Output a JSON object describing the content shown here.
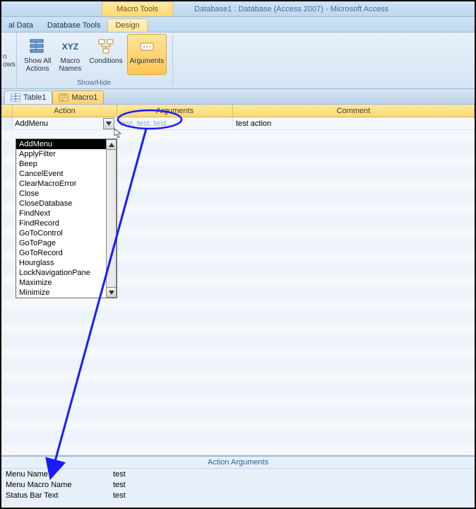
{
  "window": {
    "contextual_tab": "Macro Tools",
    "title": "Database1 : Database (Access 2007) - Microsoft Access"
  },
  "ribbon_tabs": {
    "external_data": "al Data",
    "db_tools": "Database Tools",
    "design": "Design"
  },
  "ribbon_left": {
    "line1": "n",
    "line2": "ows"
  },
  "ribbon_buttons": {
    "show_all": "Show All\nActions",
    "macro_names": "Macro\nNames",
    "conditions": "Conditions",
    "arguments": "Arguments"
  },
  "ribbon_group_label": "Show/Hide",
  "object_tabs": {
    "table1": "Table1",
    "macro1": "Macro1"
  },
  "grid_headers": {
    "action": "Action",
    "arguments": "Arguments",
    "comment": "Comment"
  },
  "row": {
    "action_value": "AddMenu",
    "args_preview": "test, test, test",
    "comment": "test action"
  },
  "action_dropdown": [
    "AddMenu",
    "ApplyFilter",
    "Beep",
    "CancelEvent",
    "ClearMacroError",
    "Close",
    "CloseDatabase",
    "FindNext",
    "FindRecord",
    "GoToControl",
    "GoToPage",
    "GoToRecord",
    "Hourglass",
    "LockNavigationPane",
    "Maximize",
    "Minimize"
  ],
  "args_panel": {
    "title": "Action Arguments",
    "rows": [
      {
        "label": "Menu Name",
        "value": "test"
      },
      {
        "label": "Menu Macro Name",
        "value": "test"
      },
      {
        "label": "Status Bar Text",
        "value": "test"
      }
    ]
  }
}
